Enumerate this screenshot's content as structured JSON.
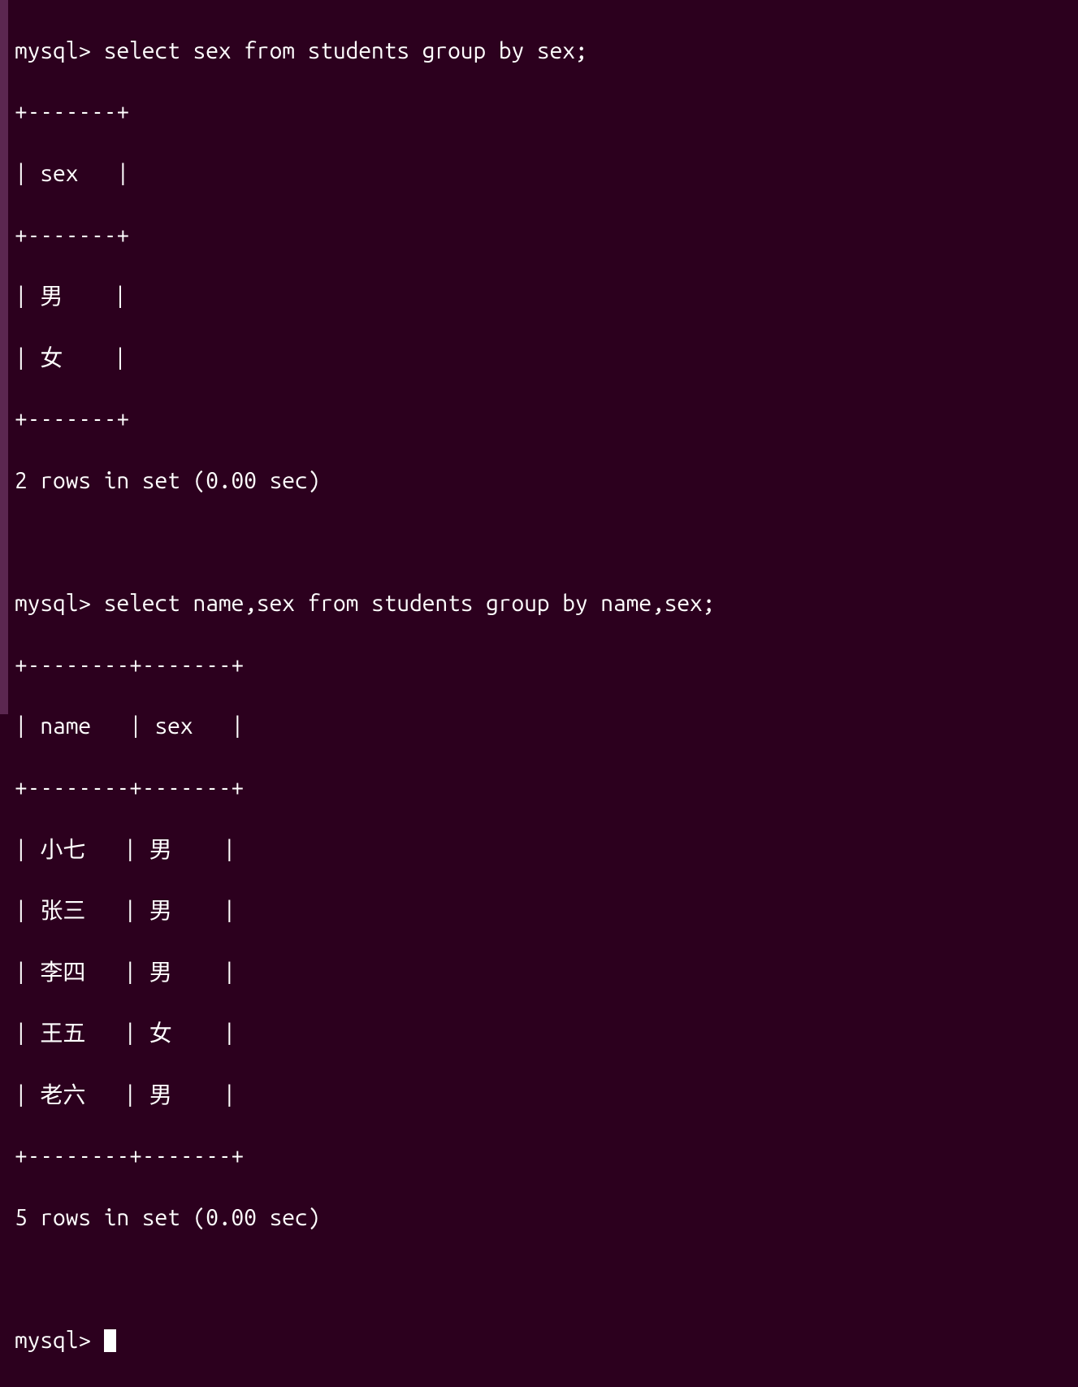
{
  "prompt": "mysql> ",
  "query1": {
    "command": "select sex from students group by sex;",
    "tableBorder": "+-------+",
    "headerRow": "| sex   |",
    "rows": [
      "| 男    |",
      "| 女    |"
    ],
    "summary": "2 rows in set (0.00 sec)"
  },
  "query2": {
    "command": "select name,sex from students group by name,sex;",
    "tableBorder": "+--------+-------+",
    "headerRow": "| name   | sex   |",
    "rows": [
      "| 小七   | 男    |",
      "| 张三   | 男    |",
      "| 李四   | 男    |",
      "| 王五   | 女    |",
      "| 老六   | 男    |"
    ],
    "summary": "5 rows in set (0.00 sec)"
  }
}
